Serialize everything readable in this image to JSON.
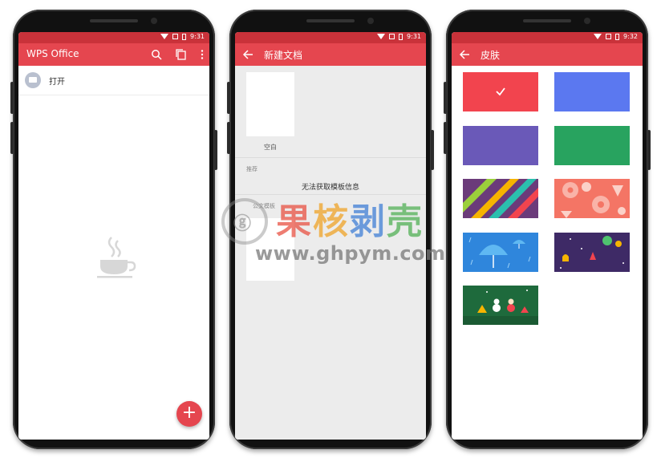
{
  "phone1": {
    "time": "9:31",
    "app_title": "WPS Office",
    "open_label": "打开",
    "fab_label": "+"
  },
  "phone2": {
    "time": "9:31",
    "title": "新建文档",
    "blank_label": "空白",
    "recommend_label": "推荐",
    "error_text": "无法获取模板信息",
    "template_label": "公文模板"
  },
  "phone3": {
    "time": "9:32",
    "title": "皮肤",
    "skins": [
      {
        "name": "red",
        "color": "#f2444e",
        "selected": true
      },
      {
        "name": "blue",
        "color": "#5b78f0",
        "selected": false
      },
      {
        "name": "purple",
        "color": "#6a59b8",
        "selected": false
      },
      {
        "name": "green",
        "color": "#28a35f",
        "selected": false
      },
      {
        "name": "stripes",
        "color": "#6b3b7a",
        "selected": false
      },
      {
        "name": "donuts",
        "color": "#f47565",
        "selected": false
      },
      {
        "name": "umbrella",
        "color": "#2f86dc",
        "selected": false
      },
      {
        "name": "space",
        "color": "#3e2a66",
        "selected": false
      },
      {
        "name": "christmas",
        "color": "#1e6a3c",
        "selected": false
      }
    ]
  },
  "colors": {
    "accent": "#e5464f",
    "statusbar": "#c9323a"
  },
  "watermark": {
    "logo_char": "ⓖ",
    "chars": [
      "果",
      "核",
      "剥",
      "壳"
    ],
    "char_colors": [
      "#e84c3d",
      "#f0a020",
      "#3a7bd5",
      "#4caf50"
    ],
    "url": "www.ghpym.com"
  }
}
